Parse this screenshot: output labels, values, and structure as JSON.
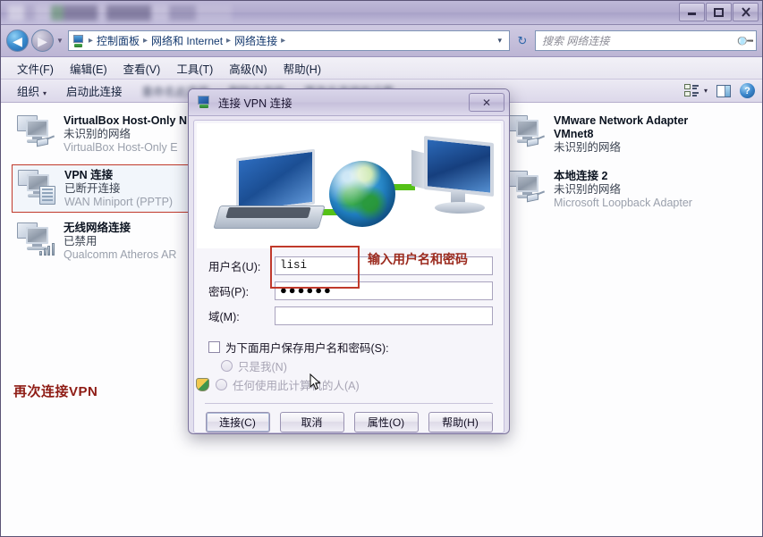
{
  "window": {
    "title_obscured": "",
    "controls": {
      "minimize": "minimize-icon",
      "maximize": "maximize-icon",
      "close": "close-icon"
    }
  },
  "address_bar": {
    "back_icon": "back-arrow-icon",
    "forward_icon": "forward-arrow-icon",
    "history_caret": "chevron-down-icon",
    "location_icon": "network-folder-icon",
    "breadcrumb": [
      "控制面板",
      "网络和 Internet",
      "网络连接"
    ],
    "separator": "▸",
    "dropdown_caret": "▾",
    "refresh_icon": "↻"
  },
  "search": {
    "placeholder": "搜索 网络连接",
    "icon": "search-icon"
  },
  "menu_bar": {
    "items": [
      "文件(F)",
      "编辑(E)",
      "查看(V)",
      "工具(T)",
      "高级(N)",
      "帮助(H)"
    ]
  },
  "command_bar": {
    "organize": "组织",
    "organize_caret": "▾",
    "items": [
      "启动此连接",
      "重命名此连接",
      "删除此连接",
      "更改此连接的设置"
    ],
    "view_icon": "view-layout-icon",
    "view_caret": "▾",
    "preview_pane_icon": "preview-pane-icon",
    "help_icon": "?"
  },
  "connections": [
    {
      "name": "VirtualBox Host-Only N",
      "status": "未识别的网络",
      "device": "VirtualBox Host-Only E",
      "selected": false,
      "badge": "plug"
    },
    {
      "name": "VPN 连接",
      "status": "已断开连接",
      "device": "WAN Miniport (PPTP)",
      "selected": true,
      "badge": "stack"
    },
    {
      "name": "无线网络连接",
      "status": "已禁用",
      "device": "Qualcomm Atheros AR",
      "selected": false,
      "badge": "bars"
    },
    {
      "name": "VMware Network Adapter",
      "name2": "VMnet8",
      "status": "未识别的网络",
      "device": "",
      "selected": false,
      "badge": "plug"
    },
    {
      "name": "本地连接 2",
      "status": "未识别的网络",
      "device": "Microsoft Loopback Adapter",
      "selected": false,
      "badge": "plug"
    }
  ],
  "annotations": {
    "reconnect_vpn": "再次连接VPN",
    "enter_credentials": "输入用户名和密码",
    "color": "#8e1b14"
  },
  "dialog": {
    "title": "连接 VPN 连接",
    "icon": "vpn-connection-icon",
    "close_label": "✕",
    "banner_alt": "laptop-globe-monitor-illustration",
    "fields": [
      {
        "label": "用户名(U):",
        "value": "lisi",
        "type": "text"
      },
      {
        "label": "密码(P):",
        "value": "●●●●●●",
        "type": "password"
      },
      {
        "label": "域(M):",
        "value": "",
        "type": "text"
      }
    ],
    "save_checkbox": {
      "label": "为下面用户保存用户名和密码(S):",
      "checked": false
    },
    "radios": [
      {
        "label": "只是我(N)",
        "selected": false,
        "shield": false
      },
      {
        "label": "任何使用此计算机的人(A)",
        "selected": false,
        "shield": true
      }
    ],
    "buttons": [
      {
        "label": "连接(C)",
        "default": true
      },
      {
        "label": "取消",
        "default": false
      },
      {
        "label": "属性(O)",
        "default": false
      },
      {
        "label": "帮助(H)",
        "default": false
      }
    ]
  }
}
